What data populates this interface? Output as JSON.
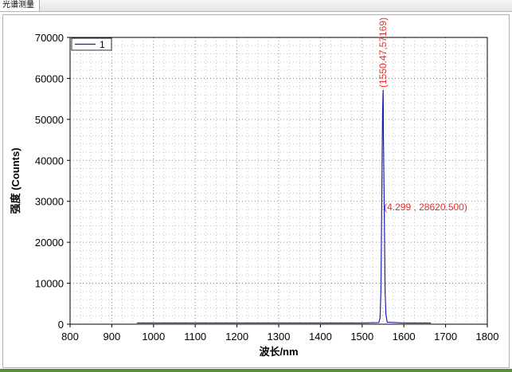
{
  "tab": {
    "label": "光谱测量"
  },
  "colors": {
    "series": "#1f1fb4",
    "annotation": "#e03030",
    "footer": "#5b8c3a"
  },
  "chart_data": {
    "type": "line",
    "title": "",
    "xlabel": "波长/nm",
    "ylabel": "强度 (Counts)",
    "xlim": [
      800,
      1800
    ],
    "ylim": [
      0,
      70000
    ],
    "xticks": [
      800,
      900,
      1000,
      1100,
      1200,
      1300,
      1400,
      1500,
      1600,
      1700,
      1800
    ],
    "yticks": [
      0,
      10000,
      20000,
      30000,
      40000,
      50000,
      60000,
      70000
    ],
    "grid": true,
    "legend": {
      "placement": "top-left"
    },
    "series": [
      {
        "name": "1",
        "x": [
          960,
          1100,
          1300,
          1500,
          1540,
          1543,
          1545,
          1547,
          1548,
          1549,
          1550,
          1550.47,
          1551,
          1552,
          1553,
          1554,
          1555,
          1557,
          1560,
          1600,
          1665
        ],
        "y": [
          300,
          300,
          300,
          300,
          400,
          1500,
          8000,
          30000,
          42000,
          52000,
          56000,
          57169,
          46000,
          38000,
          28000,
          18000,
          8000,
          2500,
          500,
          300,
          300
        ]
      }
    ],
    "annotations": [
      {
        "text": "(1550.47,57169)",
        "x": 1550.47,
        "y": 57169,
        "orientation": "vertical"
      },
      {
        "text": "(4.299 , 28620.500)",
        "x": 1554,
        "y": 28620.5,
        "orientation": "horizontal"
      }
    ]
  }
}
